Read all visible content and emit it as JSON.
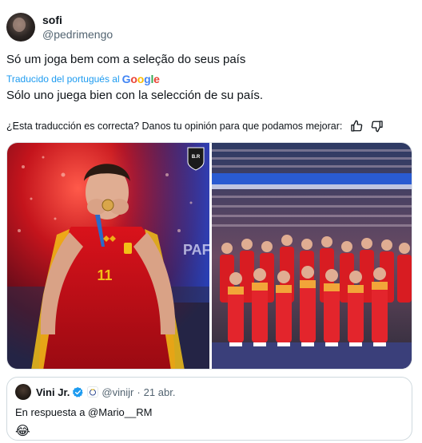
{
  "author": {
    "name": "sofi",
    "handle": "@pedrimengo"
  },
  "tweet": {
    "text": "Só um joga bem com a seleção do seus país",
    "translated_from": "Traducido del portugués al",
    "translation_provider": "Google",
    "translation": "Sólo uno juega bien con la selección de su país."
  },
  "feedback": {
    "question": "¿Esta traducción es correcta? Danos tu opinión para que podamos mejorar:",
    "like_icon": "thumbs-up-icon",
    "dislike_icon": "thumbs-down-icon"
  },
  "media": {
    "left_overlay": "PAF",
    "left_badge": "B.R",
    "jersey_number": "11"
  },
  "quoted": {
    "name": "Vini Jr.",
    "handle": "@vinijr",
    "separator": "·",
    "time": "21 abr.",
    "reply_to": "En respuesta a @Mario__RM",
    "emoji": "😂"
  },
  "colors": {
    "accent": "#1d9bf0",
    "text": "#0f1419",
    "secondary": "#536471"
  }
}
